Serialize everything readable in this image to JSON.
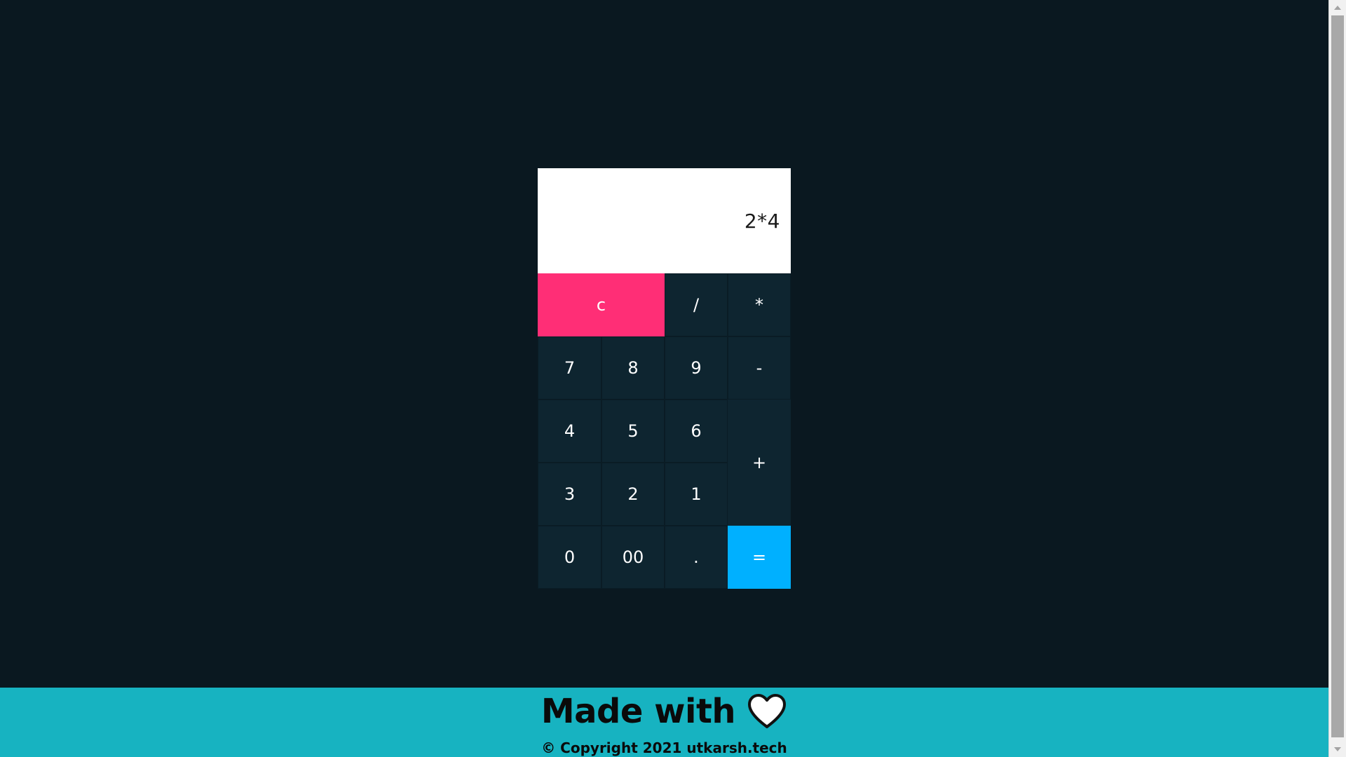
{
  "calculator": {
    "display_value": "2*4",
    "keys": {
      "clear": "c",
      "divide": "/",
      "multiply": "*",
      "seven": "7",
      "eight": "8",
      "nine": "9",
      "minus": "-",
      "four": "4",
      "five": "5",
      "six": "6",
      "plus": "+",
      "three": "3",
      "two": "2",
      "one": "1",
      "zero": "0",
      "double_zero": "00",
      "decimal": ".",
      "equals": "="
    }
  },
  "footer": {
    "title": "Made with",
    "icon": "heart-icon",
    "copyright": "© Copyright 2021 utkarsh.tech"
  },
  "colors": {
    "background": "#0a1820",
    "key_background": "#0e2530",
    "clear_accent": "#ff2e76",
    "equals_accent": "#00b0ff",
    "footer_background": "#17b3c1"
  }
}
